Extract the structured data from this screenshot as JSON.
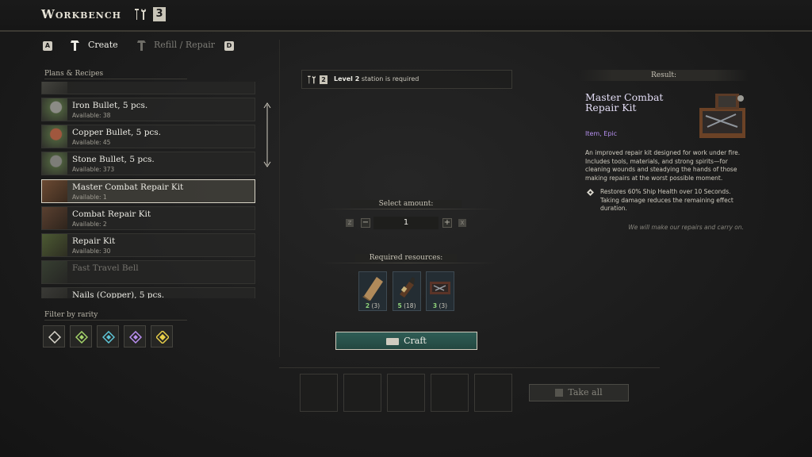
{
  "header": {
    "title": "Workbench",
    "tools_icon": "hammer-wrench-icon",
    "station_level": "3"
  },
  "tabs": {
    "prev_key": "A",
    "next_key": "D",
    "create_label": "Create",
    "repair_label": "Refill / Repair"
  },
  "recipes": {
    "section_label": "Plans & Recipes",
    "items": [
      {
        "name": "Iron Bullet, 5 pcs.",
        "available": "Available: 38",
        "icon": "iron-bullets-icon"
      },
      {
        "name": "Copper Bullet, 5 pcs.",
        "available": "Available: 45",
        "icon": "copper-bullets-icon"
      },
      {
        "name": "Stone Bullet, 5 pcs.",
        "available": "Available: 373",
        "icon": "stone-bullets-icon"
      },
      {
        "name": "Master Combat Repair Kit",
        "available": "Available: 1",
        "icon": "master-repair-kit-icon",
        "selected": true
      },
      {
        "name": "Combat Repair Kit",
        "available": "Available: 2",
        "icon": "combat-repair-kit-icon"
      },
      {
        "name": "Repair Kit",
        "available": "Available: 30",
        "icon": "repair-kit-icon"
      },
      {
        "name": "Fast Travel Bell",
        "available": "",
        "icon": "bell-icon",
        "disabled": true
      },
      {
        "name": "Nails (Copper), 5 pcs.",
        "available": "",
        "icon": "nails-icon"
      }
    ]
  },
  "filter": {
    "label": "Filter by rarity",
    "rarities": [
      {
        "name": "common",
        "color": "#d9d6cc"
      },
      {
        "name": "uncommon",
        "color": "#a4d46a"
      },
      {
        "name": "rare",
        "color": "#5ec6d8"
      },
      {
        "name": "epic",
        "color": "#b98ef0"
      },
      {
        "name": "legendary",
        "color": "#e8cf4a"
      }
    ]
  },
  "station": {
    "level_text": "Level 2",
    "suffix_text": "station is required",
    "badge": "2"
  },
  "amount": {
    "label": "Select amount:",
    "value": "1",
    "dec_key": "Z",
    "inc_key": "X",
    "minus": "−",
    "plus": "+"
  },
  "resources": {
    "label": "Required resources:",
    "items": [
      {
        "icon": "wood-plank-icon",
        "have": "2",
        "total": "(3)"
      },
      {
        "icon": "bottle-icon",
        "have": "5",
        "total": "(18)"
      },
      {
        "icon": "tool-case-icon",
        "have": "3",
        "total": "(3)"
      }
    ]
  },
  "craft": {
    "label": "Craft"
  },
  "output": {
    "takeall_label": "Take all",
    "takeall_key": "F"
  },
  "result": {
    "label": "Result:",
    "name": "Master Combat Repair Kit",
    "type": "Item, Epic",
    "description": "An improved repair kit designed for work under fire. Includes tools, materials, and strong spirits—for cleaning wounds and steadying the hands of those making repairs at the worst possible moment.",
    "effect": "Restores 60% Ship Health over 10 Seconds. Taking damage reduces the remaining effect duration.",
    "flavor": "We will make our repairs and carry on.",
    "accent_color": "#b690f0"
  }
}
